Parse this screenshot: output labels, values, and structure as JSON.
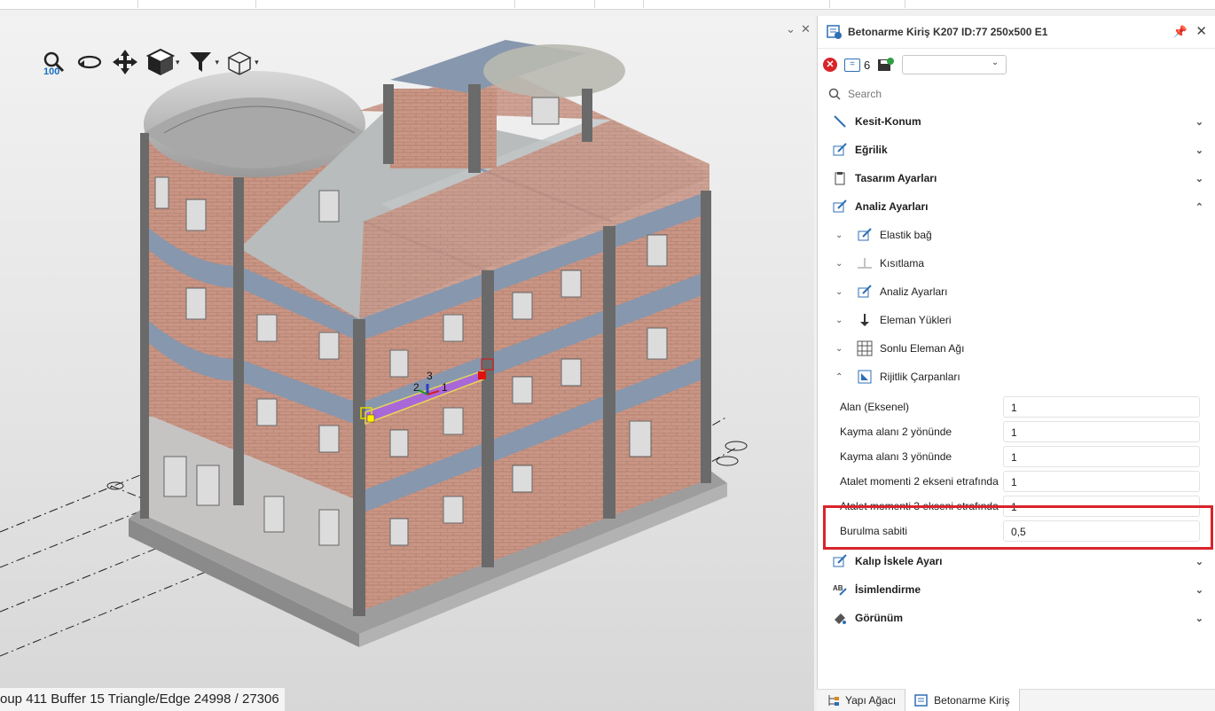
{
  "viewport": {
    "zoom_label": "100",
    "axis_labels": [
      "2",
      "3",
      "1"
    ],
    "status": "oup  411  Buffer  15  Triangle/Edge  24998 / 27306"
  },
  "panel": {
    "title": "Betonarme Kiriş K207 ID:77 250x500 E1",
    "count": "6",
    "combo_value": "",
    "search_placeholder": "Search",
    "sections": {
      "kesit": "Kesit-Konum",
      "egrilik": "Eğrilik",
      "tasarim": "Tasarım Ayarları",
      "analiz": "Analiz Ayarları",
      "kalip": "Kalıp İskele Ayarı",
      "isim": "İsimlendirme",
      "gorunum": "Görünüm"
    },
    "subsections": {
      "elastik": "Elastik bağ",
      "kisitlama": "Kısıtlama",
      "analiz2": "Analiz Ayarları",
      "yukler": "Eleman Yükleri",
      "sonlu": "Sonlu Eleman Ağı",
      "rijitlik": "Rijitlik Çarpanları"
    },
    "properties": [
      {
        "label": "Alan (Eksenel)",
        "value": "1"
      },
      {
        "label": "Kayma alanı 2 yönünde",
        "value": "1"
      },
      {
        "label": "Kayma alanı 3 yönünde",
        "value": "1"
      },
      {
        "label": "Atalet momenti 2 ekseni etrafında",
        "value": "1"
      },
      {
        "label": "Atalet momenti 3 ekseni etrafında",
        "value": "1"
      },
      {
        "label": "Burulma sabiti",
        "value": "0,5"
      }
    ]
  },
  "tabs": {
    "yapi": "Yapı Ağacı",
    "kiris": "Betonarme Kiriş"
  }
}
